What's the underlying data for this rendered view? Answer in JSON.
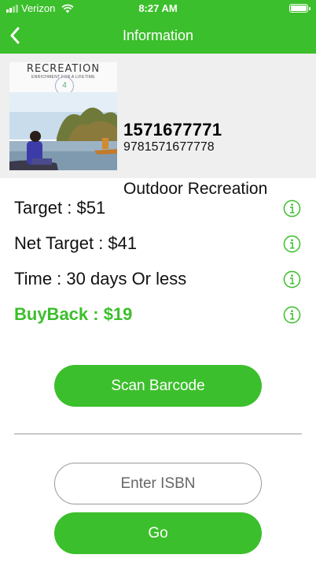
{
  "status_bar": {
    "carrier": "Verizon",
    "time": "8:27 AM"
  },
  "nav": {
    "title": "Information",
    "back_icon": "chevron-left-icon"
  },
  "book": {
    "cover": {
      "title": "RECREATION",
      "subtitle": "ENRICHMENT FOR A LIFETIME",
      "edition": "4"
    },
    "isbn10": "1571677771",
    "isbn13": "9781571677778",
    "title": "Outdoor Recreation"
  },
  "details": [
    {
      "label": "Target : $51"
    },
    {
      "label": "Net Target : $41"
    },
    {
      "label": "Time : 30 days Or less"
    },
    {
      "label": "BuyBack : $19"
    }
  ],
  "scan_button": {
    "label": "Scan Barcode"
  },
  "isbn_input": {
    "placeholder": "Enter ISBN",
    "value": ""
  },
  "go_button": {
    "label": "Go"
  },
  "colors": {
    "accent": "#3cbf2c",
    "book_panel_bg": "#efefef"
  }
}
